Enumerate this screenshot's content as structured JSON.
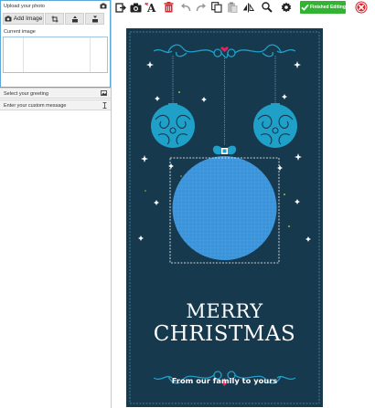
{
  "left_panel": {
    "upload_label": "Upload your photo",
    "add_image_label": "Add Image",
    "current_image_label": "Current image",
    "select_greeting_label": "Select your greeting",
    "custom_message_label": "Enter your custom message"
  },
  "toolbar": {
    "finished_label": "Finished Editing",
    "accent_color": "#34b233",
    "close_color": "#e0242c"
  },
  "card": {
    "line1": "MERRY",
    "line2": "CHRISTMAS",
    "subtitle": "From our family to yours",
    "background_color": "#17394e",
    "ornament_color": "#1ea0c8",
    "photo_placeholder_color": "#3b93d9",
    "heart_color": "#e0245e"
  }
}
